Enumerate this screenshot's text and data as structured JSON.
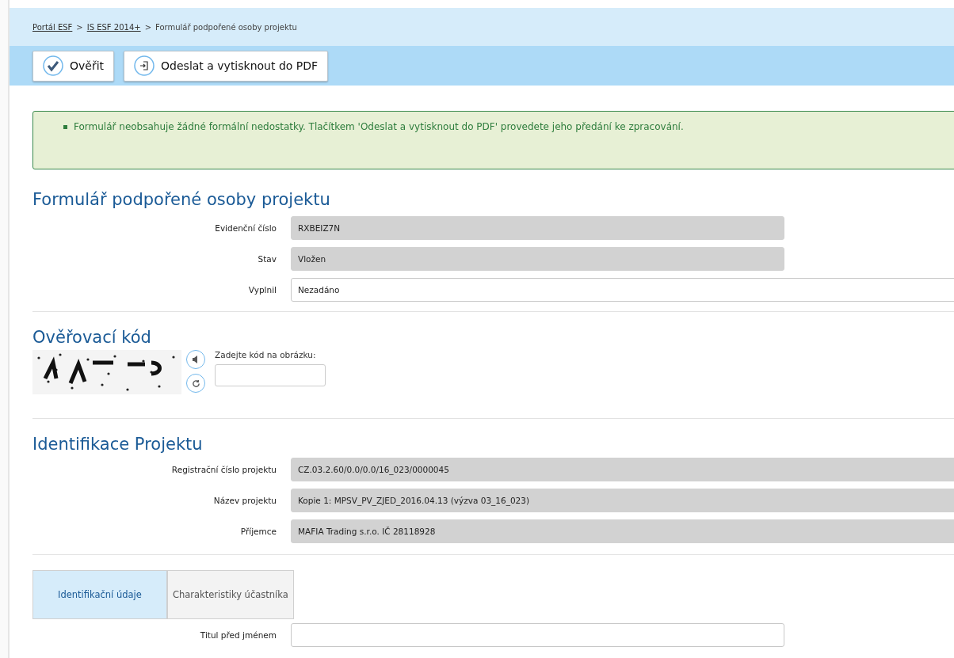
{
  "breadcrumb": [
    {
      "label": "Portál ESF",
      "kind": "link"
    },
    {
      "label": ">",
      "kind": "separator"
    },
    {
      "label": "IS ESF 2014+",
      "kind": "link"
    },
    {
      "label": ">",
      "kind": "separator"
    },
    {
      "label": "Formulář podpořené osoby projektu",
      "kind": "current"
    }
  ],
  "toolbar": [
    {
      "label": "Ověřit"
    },
    {
      "label": "Odeslat a vytisknout do PDF"
    }
  ],
  "alert": {
    "message": "Formulář neobsahuje žádné formální nedostatky. Tlačítkem 'Odeslat a vytisknout do PDF' provedete jeho předání ke zpracování."
  },
  "form_title": "Formulář podpořené osoby projektu",
  "form_fields": [
    {
      "label": "Evidenční číslo",
      "value": "RXBEIZ7N",
      "kind": "readonly"
    },
    {
      "label": "Stav",
      "value": "Vložen",
      "kind": "readonly"
    },
    {
      "label": "Vyplnil",
      "value": "Nezadáno",
      "kind": "input"
    }
  ],
  "captcha": {
    "title": "Ověřovací kód",
    "prompt": "Zadejte kód na obrázku:"
  },
  "project": {
    "title": "Identifikace Projektu",
    "fields": [
      {
        "label": "Registrační číslo projektu",
        "value": "CZ.03.2.60/0.0/0.0/16_023/0000045",
        "kind": "readonly"
      },
      {
        "label": "Název projektu",
        "value": "Kopie 1: MPSV_PV_ZJED_2016.04.13 (výzva 03_16_023)",
        "kind": "readonly"
      },
      {
        "label": "Příjemce",
        "value": "MAFIA Trading s.r.o. IČ 28118928",
        "kind": "readonly"
      }
    ]
  },
  "tabs": [
    {
      "label": "Identifikační údaje",
      "selected": true
    },
    {
      "label": "Charakteristiky účastníka",
      "selected": false
    }
  ],
  "tab_fields": [
    {
      "label": "Titul před jménem"
    }
  ]
}
